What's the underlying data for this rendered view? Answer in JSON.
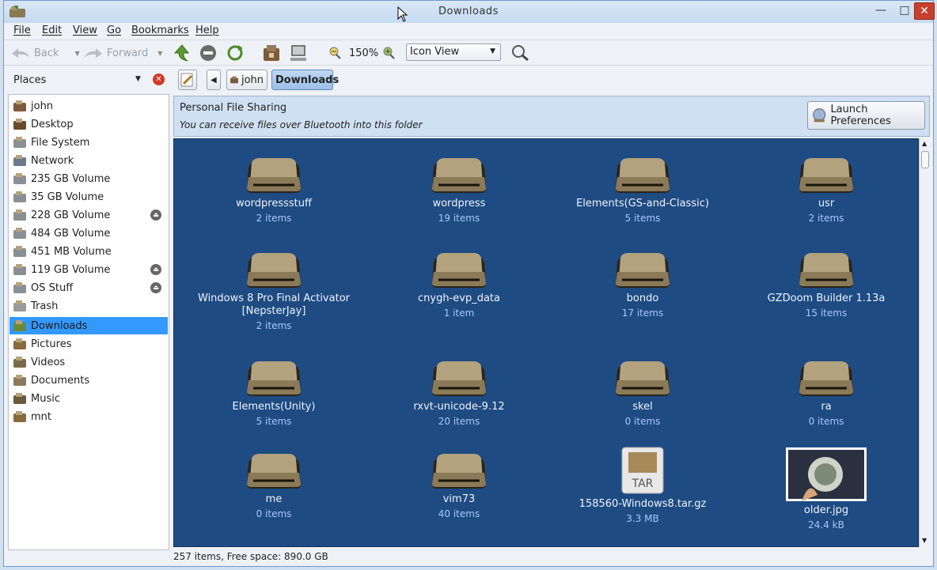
{
  "window": {
    "title": "Downloads"
  },
  "menu": [
    "File",
    "Edit",
    "View",
    "Go",
    "Bookmarks",
    "Help"
  ],
  "toolbar": {
    "back_label": "Back",
    "forward_label": "Forward",
    "zoom_level": "150%",
    "view_mode": "Icon View"
  },
  "places": {
    "header": "Places",
    "items": [
      {
        "label": "john",
        "icon": "home-folder-icon"
      },
      {
        "label": "Desktop",
        "icon": "desktop-folder-icon"
      },
      {
        "label": "File System",
        "icon": "drive-icon"
      },
      {
        "label": "Network",
        "icon": "network-icon"
      },
      {
        "label": "235 GB Volume",
        "icon": "drive-icon"
      },
      {
        "label": "35 GB Volume",
        "icon": "drive-icon"
      },
      {
        "label": "228 GB Volume",
        "icon": "drive-icon",
        "eject": true
      },
      {
        "label": "484 GB Volume",
        "icon": "drive-icon"
      },
      {
        "label": "451 MB Volume",
        "icon": "drive-icon"
      },
      {
        "label": "119 GB Volume",
        "icon": "drive-icon",
        "eject": true
      },
      {
        "label": "OS Stuff",
        "icon": "drive-icon",
        "eject": true
      },
      {
        "label": "Trash",
        "icon": "trash-icon"
      },
      {
        "label": "Downloads",
        "icon": "downloads-folder-icon",
        "selected": true
      },
      {
        "label": "Pictures",
        "icon": "pictures-folder-icon"
      },
      {
        "label": "Videos",
        "icon": "videos-folder-icon"
      },
      {
        "label": "Documents",
        "icon": "documents-folder-icon"
      },
      {
        "label": "Music",
        "icon": "music-folder-icon"
      },
      {
        "label": "mnt",
        "icon": "folder-icon"
      }
    ]
  },
  "breadcrumb": {
    "parent": "john",
    "current": "Downloads"
  },
  "info": {
    "title": "Personal File Sharing",
    "subtitle": "You can receive files over Bluetooth into this folder",
    "button": "Launch Preferences"
  },
  "files": [
    {
      "name": "wordpressstuff",
      "meta": "2 items",
      "type": "folder"
    },
    {
      "name": "wordpress",
      "meta": "19 items",
      "type": "folder"
    },
    {
      "name": "Elements(GS-and-Classic)",
      "meta": "5 items",
      "type": "folder"
    },
    {
      "name": "usr",
      "meta": "2 items",
      "type": "folder"
    },
    {
      "name": "Windows 8 Pro Final Activator",
      "name2": "[NepsterJay]",
      "meta": "2 items",
      "type": "folder"
    },
    {
      "name": "cnygh-evp_data",
      "meta": "1 item",
      "type": "folder"
    },
    {
      "name": "bondo",
      "meta": "17 items",
      "type": "folder"
    },
    {
      "name": "GZDoom Builder 1.13a",
      "meta": "15 items",
      "type": "folder"
    },
    {
      "name": "Elements(Unity)",
      "meta": "5 items",
      "type": "folder"
    },
    {
      "name": "rxvt-unicode-9.12",
      "meta": "20 items",
      "type": "folder"
    },
    {
      "name": "skel",
      "meta": "0 items",
      "type": "folder"
    },
    {
      "name": "ra",
      "meta": "0 items",
      "type": "folder"
    },
    {
      "name": "me",
      "meta": "0 items",
      "type": "folder"
    },
    {
      "name": "vim73",
      "meta": "40 items",
      "type": "folder"
    },
    {
      "name": "158560-Windows8.tar.gz",
      "meta": "3.3 MB",
      "type": "archive",
      "badge": "TAR"
    },
    {
      "name": "older.jpg",
      "meta": "24.4 kB",
      "type": "image"
    }
  ],
  "status": "257 items, Free space: 890.0 GB"
}
